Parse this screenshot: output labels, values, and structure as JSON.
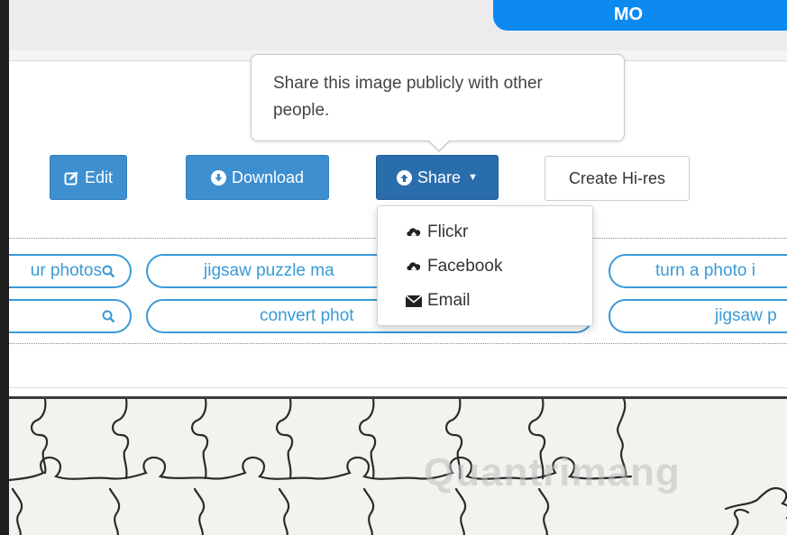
{
  "header": {
    "user_button_label": "MO"
  },
  "toolbar": {
    "edit_label": "Edit",
    "download_label": "Download",
    "share_label": "Share",
    "hires_label": "Create Hi-res"
  },
  "tooltip": {
    "text": "Share this image publicly with other people."
  },
  "share_menu": {
    "items": [
      {
        "label": "Flickr",
        "icon": "cloud-upload-icon"
      },
      {
        "label": "Facebook",
        "icon": "cloud-upload-icon"
      },
      {
        "label": "Email",
        "icon": "envelope-icon"
      }
    ]
  },
  "tags": {
    "row1": [
      "ur photos",
      "jigsaw puzzle ma",
      "turn a photo i"
    ],
    "row2": [
      "",
      "convert phot",
      "jigsaw p"
    ]
  },
  "watermark": {
    "text": "Quantrimang"
  },
  "colors": {
    "primary_blue": "#3d8fd0",
    "share_blue": "#2a6dad",
    "tag_blue": "#3a9ad6",
    "top_button_blue": "#0d8af0"
  }
}
